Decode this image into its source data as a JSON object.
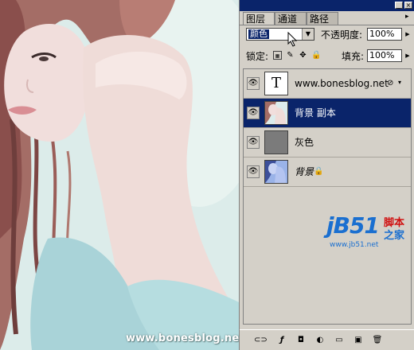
{
  "photo": {
    "watermark": "www.bonesblog.net"
  },
  "panel": {
    "tabs": [
      {
        "label": "图层",
        "active": true
      },
      {
        "label": "通道",
        "active": false
      },
      {
        "label": "路径",
        "active": false
      }
    ],
    "blend_mode": "颜色",
    "opacity_label": "不透明度:",
    "opacity_value": "100%",
    "lock_label": "锁定:",
    "fill_label": "填充:",
    "fill_value": "100%",
    "layers": [
      {
        "name": "www.bonesblog.net",
        "type": "text",
        "thumb_glyph": "T",
        "selected": false
      },
      {
        "name": "背景 副本",
        "type": "image",
        "selected": true
      },
      {
        "name": "灰色",
        "type": "fill",
        "selected": false
      },
      {
        "name": "背景",
        "type": "image",
        "selected": false
      }
    ],
    "accent_color": "#0a246a"
  },
  "logo": {
    "brand": "jB51",
    "line1": "脚本",
    "line2": "之家",
    "url": "www.jb51.net",
    "red": "#d01010",
    "blue": "#1a6fd0"
  }
}
